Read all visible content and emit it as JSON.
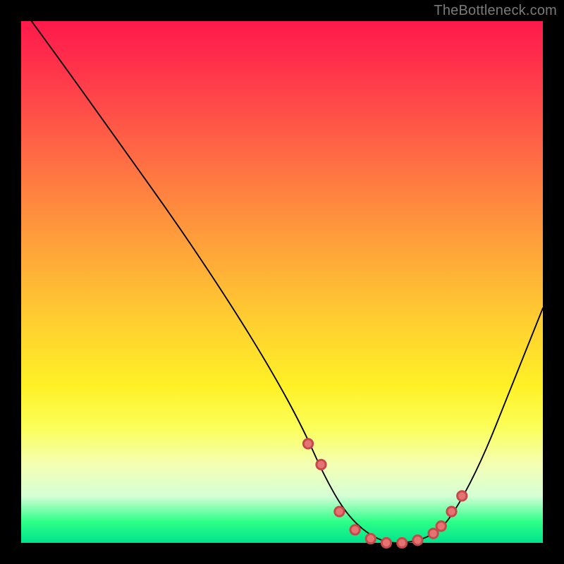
{
  "watermark": "TheBottleneck.com",
  "chart_data": {
    "type": "line",
    "title": "",
    "xlabel": "",
    "ylabel": "",
    "xlim": [
      0,
      100
    ],
    "ylim": [
      0,
      100
    ],
    "grid": false,
    "series": [
      {
        "name": "curve",
        "x": [
          2,
          10,
          20,
          30,
          40,
          48,
          54,
          58,
          62,
          66,
          70,
          74,
          78,
          82,
          88,
          94,
          100
        ],
        "y": [
          100,
          89,
          75,
          61,
          46,
          33,
          22,
          13,
          6,
          2,
          0,
          0,
          1,
          4,
          15,
          30,
          45
        ]
      },
      {
        "name": "markers",
        "x": [
          55,
          57.5,
          61,
          64,
          67,
          70,
          73,
          76,
          79,
          80.5,
          82.5,
          84.5
        ],
        "y": [
          19,
          15,
          6,
          2.5,
          0.8,
          0,
          0,
          0.5,
          1.8,
          3.2,
          6,
          9
        ]
      }
    ]
  }
}
